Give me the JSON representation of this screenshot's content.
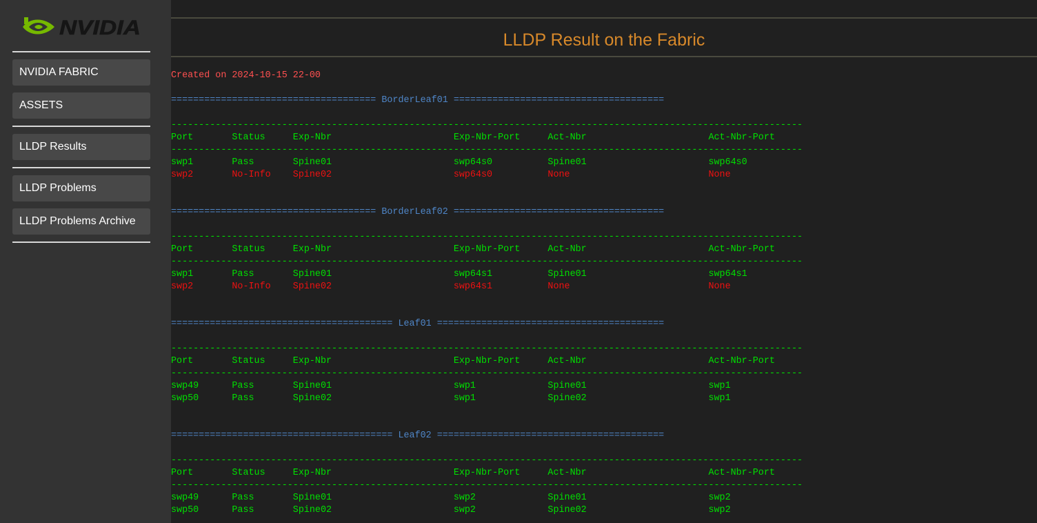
{
  "sidebar": {
    "logo_text": "NVIDIA",
    "items": [
      {
        "label": "NVIDIA FABRIC"
      },
      {
        "label": "ASSETS"
      },
      {
        "label": "LLDP Results"
      },
      {
        "label": "LLDP Problems"
      },
      {
        "label": "LLDP Problems Archive"
      }
    ]
  },
  "page": {
    "title": "LLDP Result on the Fabric",
    "created": "Created on 2024-10-15 22-00"
  },
  "columns": [
    "Port",
    "Status",
    "Exp-Nbr",
    "Exp-Nbr-Port",
    "Act-Nbr",
    "Act-Nbr-Port"
  ],
  "devices": [
    {
      "name": "BorderLeaf01",
      "rows": [
        {
          "status_type": "ok",
          "cells": [
            "swp1",
            "Pass",
            "Spine01",
            "swp64s0",
            "Spine01",
            "swp64s0"
          ]
        },
        {
          "status_type": "bad",
          "cells": [
            "swp2",
            "No-Info",
            "Spine02",
            "swp64s0",
            "None",
            "None"
          ]
        }
      ]
    },
    {
      "name": "BorderLeaf02",
      "rows": [
        {
          "status_type": "ok",
          "cells": [
            "swp1",
            "Pass",
            "Spine01",
            "swp64s1",
            "Spine01",
            "swp64s1"
          ]
        },
        {
          "status_type": "bad",
          "cells": [
            "swp2",
            "No-Info",
            "Spine02",
            "swp64s1",
            "None",
            "None"
          ]
        }
      ]
    },
    {
      "name": "Leaf01",
      "rows": [
        {
          "status_type": "ok",
          "cells": [
            "swp49",
            "Pass",
            "Spine01",
            "swp1",
            "Spine01",
            "swp1"
          ]
        },
        {
          "status_type": "ok",
          "cells": [
            "swp50",
            "Pass",
            "Spine02",
            "swp1",
            "Spine02",
            "swp1"
          ]
        }
      ]
    },
    {
      "name": "Leaf02",
      "rows": [
        {
          "status_type": "ok",
          "cells": [
            "swp49",
            "Pass",
            "Spine01",
            "swp2",
            "Spine01",
            "swp2"
          ]
        },
        {
          "status_type": "ok",
          "cells": [
            "swp50",
            "Pass",
            "Spine02",
            "swp2",
            "Spine02",
            "swp2"
          ]
        }
      ]
    }
  ],
  "colors": {
    "title": "#d8892a",
    "created": "#ff5050",
    "banner": "#4f86c8",
    "pass": "#00e000",
    "fail": "#ee1111",
    "logo_green": "#76b900"
  }
}
